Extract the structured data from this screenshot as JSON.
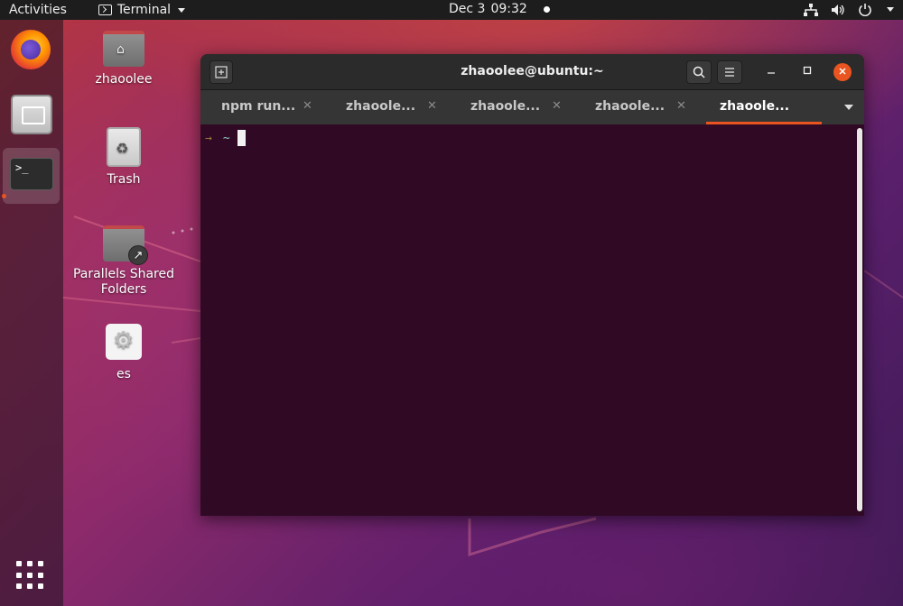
{
  "topbar": {
    "activities": "Activities",
    "app_name": "Terminal",
    "date": "Dec 3",
    "time": "09:32"
  },
  "desktop": {
    "icons": [
      {
        "label": "zhaoolee"
      },
      {
        "label": "Trash"
      },
      {
        "label": "Parallels Shared Folders"
      },
      {
        "label": "es"
      }
    ]
  },
  "window": {
    "title": "zhaoolee@ubuntu:~",
    "tabs": [
      {
        "label": "npm run...",
        "active": false
      },
      {
        "label": "zhaoole...",
        "active": false
      },
      {
        "label": "zhaoole...",
        "active": false
      },
      {
        "label": "zhaoole...",
        "active": false
      },
      {
        "label": "zhaoole...",
        "active": true
      }
    ],
    "prompt": {
      "arrow": "→",
      "path": "~"
    }
  },
  "colors": {
    "accent": "#e95420",
    "terminal_bg": "#300a24",
    "topbar_bg": "#1d1d1d"
  },
  "icons": [
    "terminal-icon",
    "network-icon",
    "volume-icon",
    "power-icon",
    "firefox-icon",
    "files-icon",
    "apps-grid-icon",
    "home-icon",
    "trash-icon",
    "link-icon",
    "settings-icon",
    "search-icon",
    "hamburger-menu-icon",
    "minimize-icon",
    "maximize-icon",
    "close-icon"
  ]
}
